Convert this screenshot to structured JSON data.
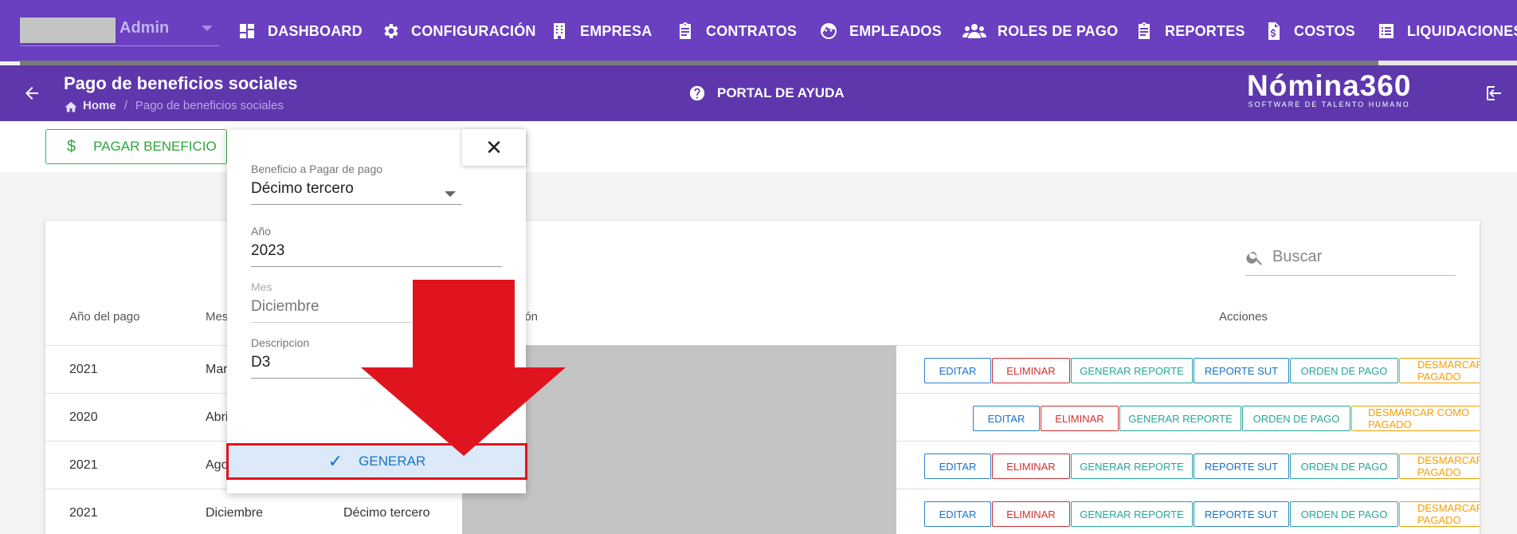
{
  "topnav": {
    "user": "Admin",
    "items": [
      {
        "label": "DASHBOARD",
        "icon": "dashboard-icon"
      },
      {
        "label": "CONFIGURACIÓN",
        "icon": "gear-icon"
      },
      {
        "label": "EMPRESA",
        "icon": "building-icon"
      },
      {
        "label": "CONTRATOS",
        "icon": "clipboard-icon"
      },
      {
        "label": "EMPLEADOS",
        "icon": "face-icon"
      },
      {
        "label": "ROLES DE PAGO",
        "icon": "group-icon"
      },
      {
        "label": "REPORTES",
        "icon": "clipboard-icon"
      },
      {
        "label": "COSTOS",
        "icon": "invoice-dollar-icon"
      },
      {
        "label": "LIQUIDACIONES",
        "icon": "list-icon"
      }
    ]
  },
  "subbar": {
    "title": "Pago de beneficios sociales",
    "breadcrumb_home": "Home",
    "breadcrumb_current": "Pago de beneficios sociales",
    "help": "PORTAL DE AYUDA",
    "brand": "Nómina360",
    "brand_tagline": "SOFTWARE DE TALENTO HUMANO"
  },
  "toolbar": {
    "pay_label": "PAGAR BENEFICIO"
  },
  "search": {
    "placeholder": "Buscar"
  },
  "table": {
    "headers": {
      "year": "Año del pago",
      "month": "Mes",
      "desc": "ión",
      "actions": "Acciones"
    },
    "rows": [
      {
        "year": "2021",
        "month": "Mar"
      },
      {
        "year": "2020",
        "month": "Abri"
      },
      {
        "year": "2021",
        "month": "Ago"
      },
      {
        "year": "2021",
        "month": "Diciembre",
        "benefit": "Décimo tercero"
      }
    ],
    "actions": {
      "edit": "EDITAR",
      "delete": "ELIMINAR",
      "report": "GENERAR REPORTE",
      "sut": "REPORTE SUT",
      "order": "ORDEN DE PAGO",
      "unmark": "DESMARCAR COMO PAGADO"
    }
  },
  "popup": {
    "benefit_label": "Beneficio a Pagar de pago",
    "benefit_value": "Décimo tercero",
    "year_label": "Año",
    "year_value": "2023",
    "month_label": "Mes",
    "month_value": "Diciembre",
    "desc_label": "Descripcion",
    "desc_value": "D3",
    "generate": "GENERAR",
    "close": "✕"
  },
  "colors": {
    "nav": "#6a3fc0",
    "subbar": "#5e37ad",
    "highlight": "#e0141f"
  }
}
